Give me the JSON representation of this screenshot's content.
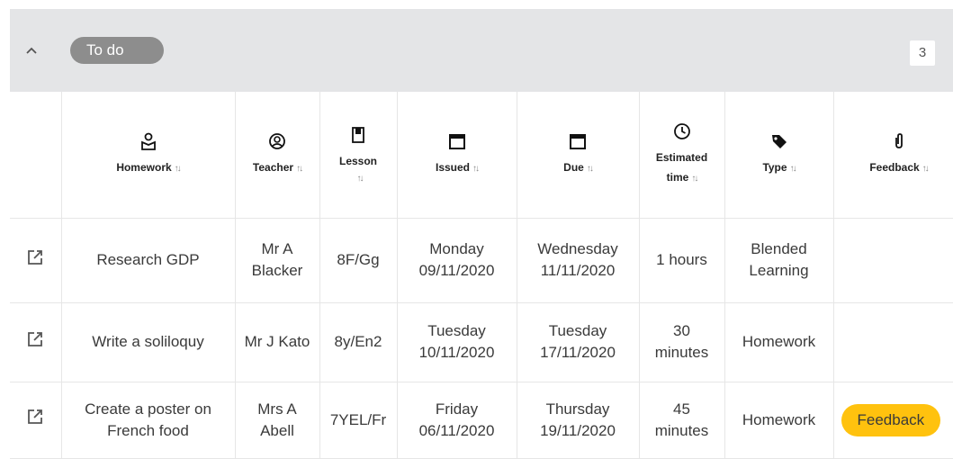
{
  "section": {
    "status_label": "To do",
    "count": "3"
  },
  "columns": [
    {
      "label": "Homework",
      "icon": "homework-icon"
    },
    {
      "label": "Teacher",
      "icon": "teacher-icon"
    },
    {
      "label": "Lesson",
      "icon": "lesson-icon"
    },
    {
      "label": "Issued",
      "icon": "calendar-icon"
    },
    {
      "label": "Due",
      "icon": "calendar-icon"
    },
    {
      "label": "Estimated time",
      "label_line1": "Estimated",
      "label_line2": "time",
      "icon": "clock-icon"
    },
    {
      "label": "Type",
      "icon": "tag-icon"
    },
    {
      "label": "Feedback",
      "icon": "paperclip-icon"
    }
  ],
  "sort_glyph": "↑↓",
  "rows": [
    {
      "homework": "Research GDP",
      "teacher_line1": "Mr A",
      "teacher_line2": "Blacker",
      "lesson": "8F/Gg",
      "issued_day": "Monday",
      "issued_date": "09/11/2020",
      "due_day": "Wednesday",
      "due_date": "11/11/2020",
      "time_line1": "1 hours",
      "time_line2": "",
      "type_line1": "Blended",
      "type_line2": "Learning",
      "feedback": ""
    },
    {
      "homework": "Write a soliloquy",
      "teacher_line1": "Mr J Kato",
      "teacher_line2": "",
      "lesson": "8y/En2",
      "issued_day": "Tuesday",
      "issued_date": "10/11/2020",
      "due_day": "Tuesday",
      "due_date": "17/11/2020",
      "time_line1": "30",
      "time_line2": "minutes",
      "type_line1": "Homework",
      "type_line2": "",
      "feedback": ""
    },
    {
      "homework_line1": "Create a poster on",
      "homework_line2": "French food",
      "teacher_line1": "Mrs A",
      "teacher_line2": "Abell",
      "lesson": "7YEL/Fr",
      "issued_day": "Friday",
      "issued_date": "06/11/2020",
      "due_day": "Thursday",
      "due_date": "19/11/2020",
      "time_line1": "45",
      "time_line2": "minutes",
      "type_line1": "Homework",
      "type_line2": "",
      "feedback": "Feedback"
    }
  ],
  "colors": {
    "header_bg": "#e4e5e7",
    "pill_bg": "#8d8d8d",
    "feedback_accent": "#ffc20e"
  }
}
